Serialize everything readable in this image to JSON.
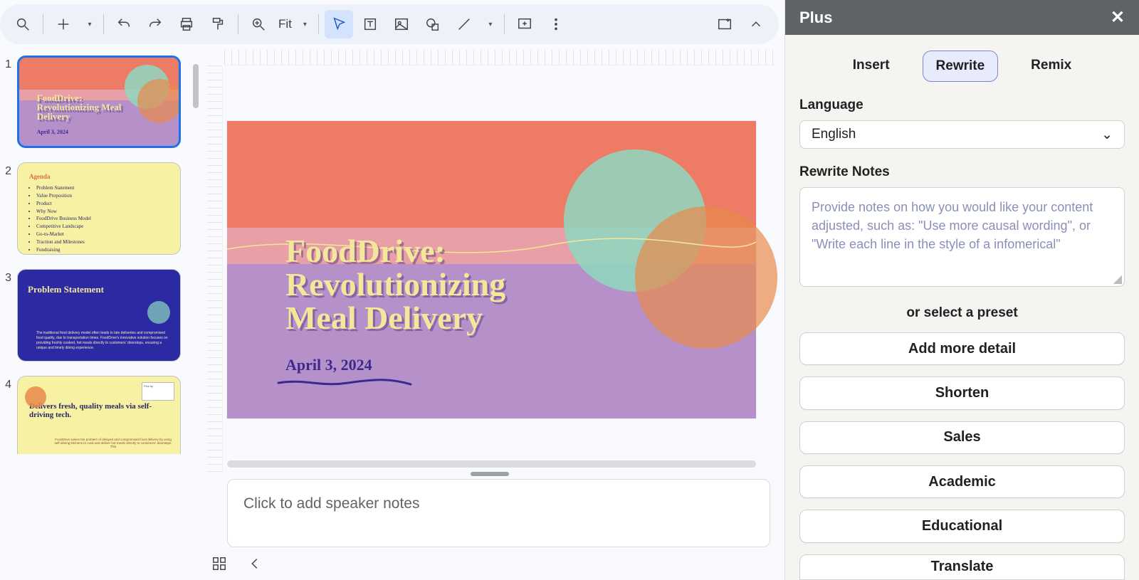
{
  "toolbar": {
    "zoom_label": "Fit"
  },
  "panel": {
    "title": "Plus",
    "tabs": {
      "insert": "Insert",
      "rewrite": "Rewrite",
      "remix": "Remix",
      "active": "rewrite"
    },
    "language_label": "Language",
    "language_value": "English",
    "rewrite_notes_label": "Rewrite Notes",
    "rewrite_notes_placeholder": "Provide notes on how you would like your content adjusted, such as: \"Use more causal wording\", or \"Write each line in the style of a infomerical\"",
    "or_preset_label": "or select a preset",
    "presets": [
      "Add more detail",
      "Shorten",
      "Sales",
      "Academic",
      "Educational",
      "Translate"
    ]
  },
  "notes": {
    "placeholder": "Click to add speaker notes"
  },
  "thumbnails": {
    "numbers": [
      "1",
      "2",
      "3",
      "4"
    ],
    "slide1": {
      "title": "FoodDrive: Revolutionizing Meal Delivery",
      "date": "April 3, 2024"
    },
    "slide2": {
      "heading": "Agenda",
      "items": [
        "Problem Statement",
        "Value Proposition",
        "Product",
        "Why Now",
        "FoodDrive Business Model",
        "Competitive Landscape",
        "Go-to-Market",
        "Traction and Milestones",
        "Fundraising"
      ]
    },
    "slide3": {
      "heading": "Problem Statement",
      "body": "The traditional food delivery model often leads to late deliveries and compromised food quality, due to transportation times. FoodDrive's innovative solution focuses on providing freshly cooked, hot meals directly to customers' doorsteps, ensuring a unique and timely dining experience."
    },
    "slide4": {
      "heading": "Delivers fresh, quality meals via self-driving tech.",
      "note_box": "Plus tip",
      "footer": "FoodDrive solves the problem of delayed and compromised food delivery by using self-driving kitchens to cook and deliver hot meals directly to customers' doorsteps. This"
    }
  },
  "main_slide": {
    "title_l1": "FoodDrive:",
    "title_l2": "Revolutionizing",
    "title_l3": "Meal Delivery",
    "date": "April 3, 2024"
  }
}
